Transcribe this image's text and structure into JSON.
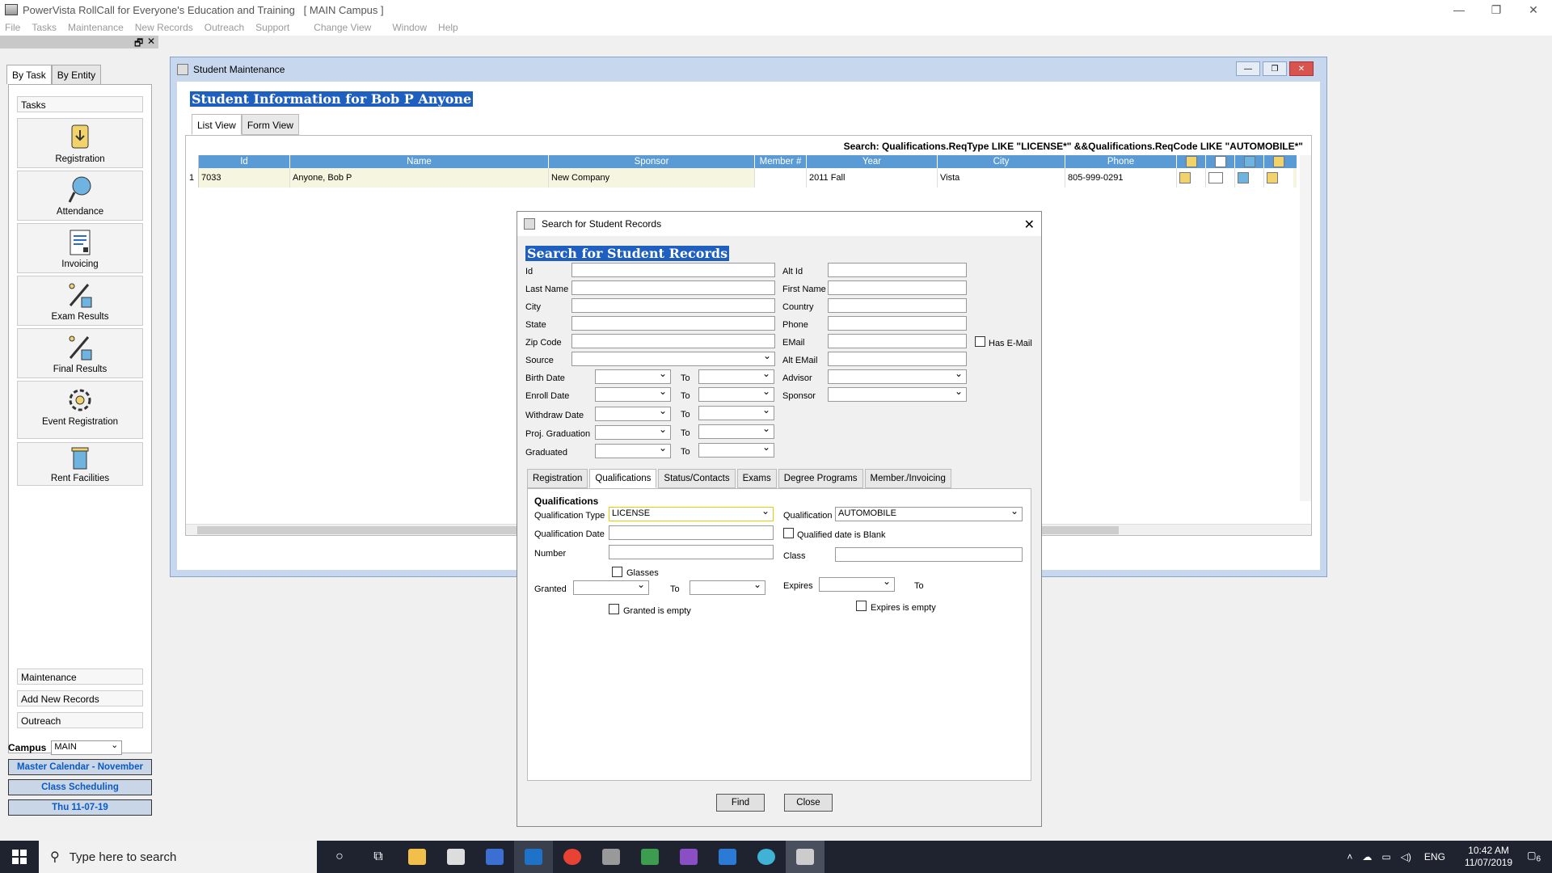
{
  "window": {
    "title": "PowerVista RollCall for Everyone's Education and Training",
    "campus_tag": "[ MAIN Campus ]",
    "minimize": "—",
    "maximize": "❐",
    "close": "✕"
  },
  "menu": [
    "File",
    "Tasks",
    "Maintenance",
    "New Records",
    "Outreach",
    "Support",
    "Change View",
    "Window",
    "Help"
  ],
  "left_pane": {
    "strip_restore": "🗗",
    "strip_close": "✕",
    "tabs": [
      "By Task",
      "By Entity"
    ],
    "tasks_header": "Tasks",
    "tasks": [
      "Registration",
      "Attendance",
      "Invoicing",
      "Exam Results",
      "Final Results",
      "Event Registration",
      "Rent Facilities"
    ],
    "sections": [
      "Maintenance",
      "Add New Records",
      "Outreach"
    ],
    "campus_label": "Campus",
    "campus_value": "MAIN",
    "buttons": [
      "Master Calendar - November",
      "Class Scheduling",
      "Thu 11-07-19"
    ]
  },
  "student_maintenance": {
    "title": "Student Maintenance",
    "heading": "Student Information  for Bob P Anyone",
    "tabs": [
      "List View",
      "Form View"
    ],
    "search_expr": "Search: Qualifications.ReqType  LIKE  \"LICENSE*\"  &&Qualifications.ReqCode  LIKE  \"AUTOMOBILE*\"",
    "columns": [
      "Id",
      "Name",
      "Sponsor",
      "Member #",
      "Year",
      "City",
      "Phone"
    ],
    "rows": [
      {
        "num": "1",
        "id": "7033",
        "name": "Anyone, Bob P",
        "sponsor": "New Company",
        "member": "",
        "year": "2011 Fall",
        "city": "Vista",
        "phone": "805-999-0291"
      }
    ]
  },
  "search_dialog": {
    "title": "Search for Student Records",
    "close": "✕",
    "heading": "Search for Student Records",
    "labels": {
      "id": "Id",
      "last_name": "Last Name",
      "city": "City",
      "state": "State",
      "zip": "Zip Code",
      "source": "Source",
      "alt_id": "Alt Id",
      "first_name": "First Name",
      "country": "Country",
      "phone": "Phone",
      "email": "EMail",
      "alt_email": "Alt EMail",
      "advisor": "Advisor",
      "sponsor": "Sponsor",
      "has_email": "Has E-Mail",
      "birth_date": "Birth Date",
      "enroll_date": "Enroll Date",
      "withdraw_date": "Withdraw Date",
      "proj_grad": "Proj. Graduation",
      "graduated": "Graduated",
      "to": "To"
    },
    "tabs": [
      "Registration",
      "Qualifications",
      "Status/Contacts",
      "Exams",
      "Degree Programs",
      "Member./Invoicing"
    ],
    "qualifications": {
      "section_title": "Qualifications",
      "type_label": "Qualification Type",
      "type_value": "LICENSE",
      "qual_label": "Qualification",
      "qual_value": "AUTOMOBILE",
      "date_label": "Qualification Date",
      "date_blank_label": "Qualified date is Blank",
      "number_label": "Number",
      "class_label": "Class",
      "glasses_label": "Glasses",
      "granted_label": "Granted",
      "to_label": "To",
      "expires_label": "Expires",
      "granted_empty_label": "Granted is empty",
      "expires_empty_label": "Expires is empty"
    },
    "buttons": {
      "find": "Find",
      "close": "Close"
    }
  },
  "taskbar": {
    "search_placeholder": "Type here to search",
    "lang": "ENG",
    "time": "10:42 AM",
    "date": "11/07/2019",
    "notif_count": "6"
  }
}
